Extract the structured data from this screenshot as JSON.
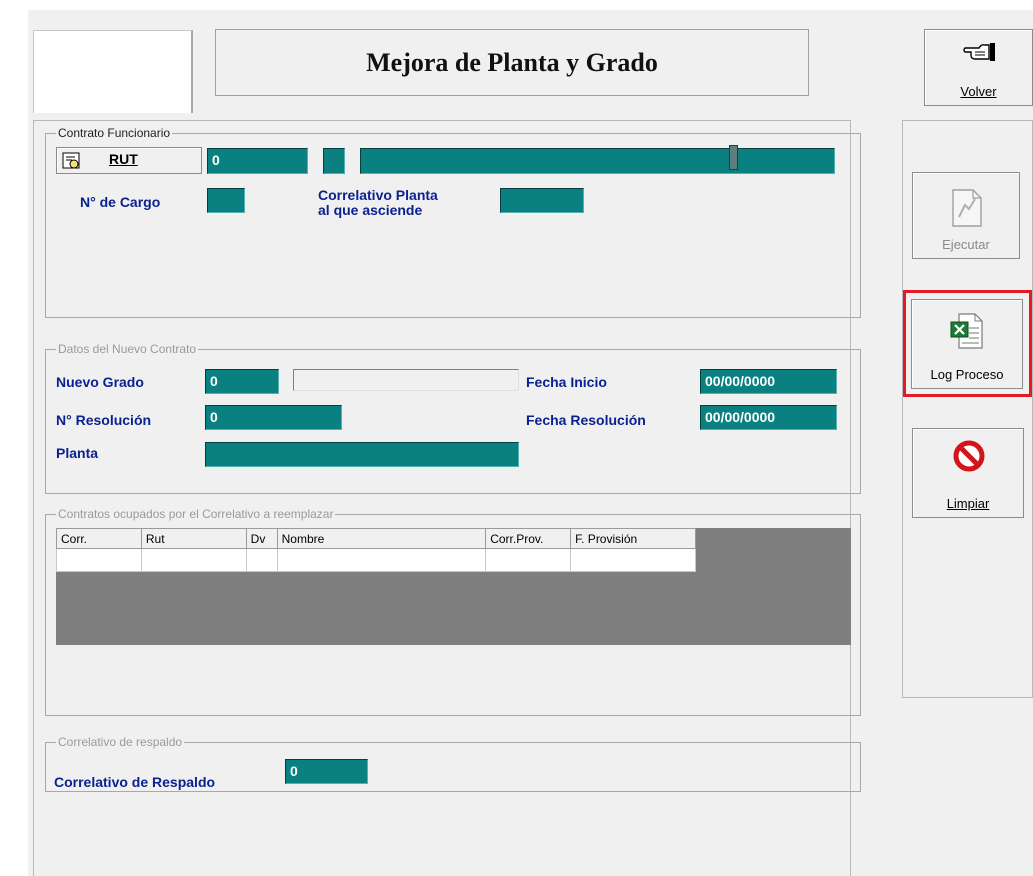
{
  "window": {
    "title": "Mejora de Planta y Grado"
  },
  "buttons": {
    "volver": "Volver",
    "ejecutar": "Ejecutar",
    "log_proceso": "Log Proceso",
    "limpiar": "Limpiar",
    "rut": "RUT"
  },
  "contrato_funcionario": {
    "legend": "Contrato Funcionario",
    "rut_value": "0",
    "rut_dv": "",
    "nombre": "",
    "n_cargo_label": "N° de Cargo",
    "n_cargo_value": "",
    "correlativo_label_1": "Correlativo Planta",
    "correlativo_label_2": "al que asciende",
    "correlativo_value": ""
  },
  "nuevo_contrato": {
    "legend": "Datos del Nuevo Contrato",
    "nuevo_grado_label": "Nuevo Grado",
    "nuevo_grado_value": "0",
    "grado_desc": "",
    "fecha_inicio_label": "Fecha Inicio",
    "fecha_inicio_value": "00/00/0000",
    "n_resolucion_label": "N° Resolución",
    "n_resolucion_value": "0",
    "fecha_resolucion_label": "Fecha Resolución",
    "fecha_resolucion_value": "00/00/0000",
    "planta_label": "Planta",
    "planta_value": ""
  },
  "contratos_ocupados": {
    "legend": "Contratos ocupados por el Correlativo a reemplazar",
    "columns": [
      "Corr.",
      "Rut",
      "Dv",
      "Nombre",
      "Corr.Prov.",
      "F. Provisión"
    ]
  },
  "correlativo_respaldo": {
    "legend": "Correlativo de respaldo",
    "label": "Correlativo de Respaldo",
    "value": "0"
  },
  "colors": {
    "field": "#0b8080",
    "label": "#0a2290",
    "highlight": "#e21b23",
    "grid": "#7f7f7f"
  },
  "icons": [
    "pointing-hand-icon",
    "document-edit-icon",
    "excel-log-icon",
    "no-sign-icon",
    "search-card-icon"
  ]
}
